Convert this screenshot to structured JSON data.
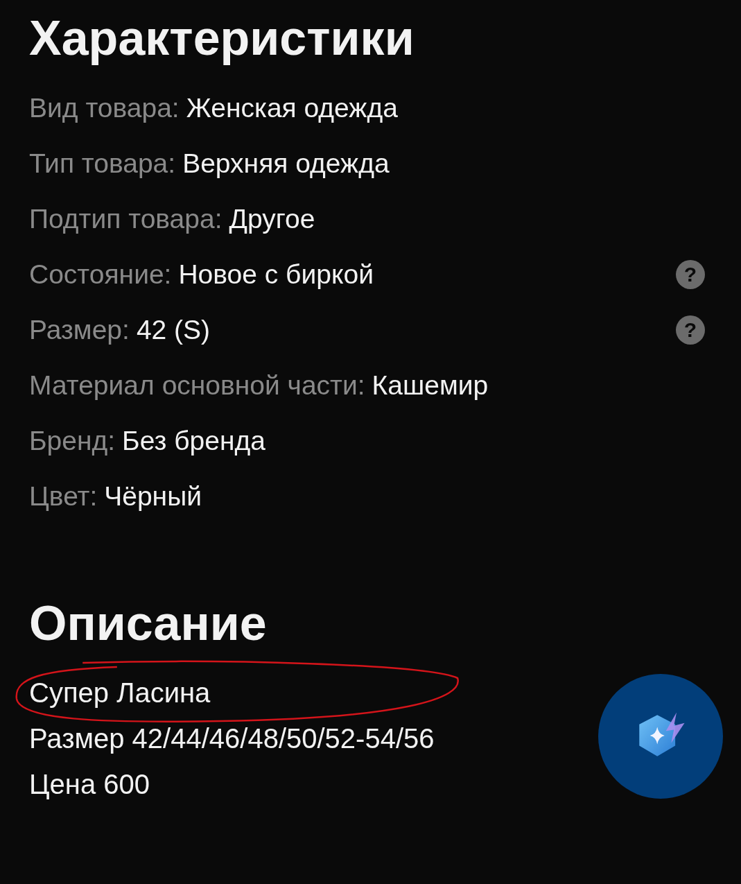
{
  "specs": {
    "title": "Характеристики",
    "rows": [
      {
        "label": "Вид товара:",
        "value": "Женская одежда"
      },
      {
        "label": "Тип товара:",
        "value": "Верхняя одежда"
      },
      {
        "label": "Подтип товара:",
        "value": "Другое"
      },
      {
        "label": "Состояние:",
        "value": "Новое с биркой",
        "hint": "?"
      },
      {
        "label": "Размер:",
        "value": "42 (S)",
        "hint": "?"
      },
      {
        "label": "Материал основной части:",
        "value": "Кашемир"
      },
      {
        "label": "Бренд:",
        "value": "Без бренда"
      },
      {
        "label": "Цвет:",
        "value": "Чёрный"
      }
    ]
  },
  "description": {
    "title": "Описание",
    "lines": [
      {
        "text": "Супер Ласина",
        "circled": true
      },
      {
        "text": "Размер 42/44/46/48/50/52-54/56",
        "circled": false
      },
      {
        "text": "Цена 600",
        "circled": false
      }
    ]
  }
}
